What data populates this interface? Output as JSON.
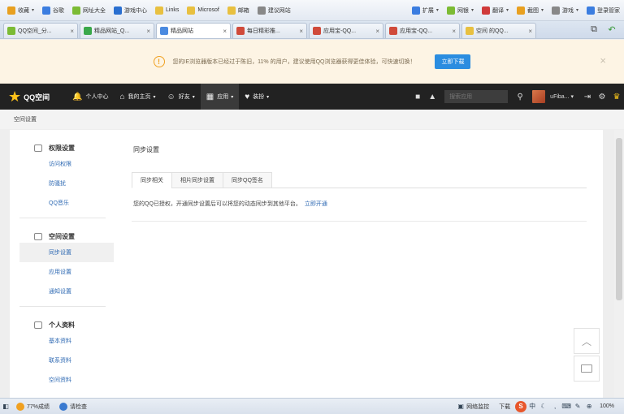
{
  "favorites": [
    {
      "label": "收藏",
      "color": "#e8a020",
      "arrow": true
    },
    {
      "label": "谷歌",
      "color": "#3b7de0",
      "arrow": false
    },
    {
      "label": "网址大全",
      "color": "#7cbb34",
      "arrow": false
    },
    {
      "label": "游戏中心",
      "color": "#2a6fd0",
      "arrow": false
    },
    {
      "label": "Links",
      "color": "#e8c040",
      "arrow": false
    },
    {
      "label": "Microsof",
      "color": "#e8c040",
      "arrow": false
    },
    {
      "label": "邮箱",
      "color": "#e8c040",
      "arrow": false
    },
    {
      "label": "建议网站",
      "color": "#888888",
      "arrow": false
    }
  ],
  "favorites_right": [
    {
      "label": "扩展",
      "color": "#3b7de0",
      "arrow": true
    },
    {
      "label": "网银",
      "color": "#7cbb34",
      "arrow": true
    },
    {
      "label": "翻译",
      "color": "#d03a3a",
      "arrow": true
    },
    {
      "label": "截图",
      "color": "#e8a020",
      "arrow": true
    },
    {
      "label": "游戏",
      "color": "#888888",
      "arrow": true
    },
    {
      "label": "登录管家",
      "color": "#3b7de0",
      "arrow": false
    }
  ],
  "tabs": [
    {
      "label": "QQ空间_分...",
      "color": "#7cbb34",
      "active": false
    },
    {
      "label": "精品网站_Q...",
      "color": "#3aa84a",
      "active": false
    },
    {
      "label": "精品网站",
      "color": "#4a8ae0",
      "active": true
    },
    {
      "label": "每日精彩推...",
      "color": "#d04a3a",
      "active": false
    },
    {
      "label": "应用宝-QQ...",
      "color": "#d04a3a",
      "active": false
    },
    {
      "label": "应用宝-QQ...",
      "color": "#d04a3a",
      "active": false
    },
    {
      "label": "空间 的QQ...",
      "color": "#e8c040",
      "active": false
    }
  ],
  "notice": {
    "message": "您的IE浏览器版本已经过于陈旧，11% 的用户，建议使用QQ浏览器获得更佳体验，可快速切换！",
    "download_label": "立即下载",
    "close_glyph": "×",
    "warn_glyph": "!"
  },
  "qqnav": {
    "logo_text": "QQ空间",
    "items": [
      {
        "label": "个人中心",
        "glyph": "🔔",
        "caret": false,
        "active": false
      },
      {
        "label": "我的主页",
        "glyph": "⌂",
        "caret": true,
        "active": false
      },
      {
        "label": "好友",
        "glyph": "☺",
        "caret": true,
        "active": false
      },
      {
        "label": "应用",
        "glyph": "▦",
        "caret": true,
        "active": true
      },
      {
        "label": "装扮",
        "glyph": "♥",
        "caret": true,
        "active": false
      }
    ],
    "search_placeholder": "搜索应用",
    "username": "uFiba...",
    "username_caret": "▾"
  },
  "breadcrumb": "空间设置",
  "sidebar": {
    "groups": [
      {
        "title": "权限设置",
        "items": [
          {
            "label": "访问权限",
            "active": false
          },
          {
            "label": "防骚扰",
            "active": false
          },
          {
            "label": "QQ音乐",
            "active": false
          }
        ]
      },
      {
        "title": "空间设置",
        "items": [
          {
            "label": "同步设置",
            "active": true
          },
          {
            "label": "应用设置",
            "active": false
          },
          {
            "label": "通知设置",
            "active": false
          }
        ]
      },
      {
        "title": "个人资料",
        "items": [
          {
            "label": "基本资料",
            "active": false
          },
          {
            "label": "联系资料",
            "active": false
          },
          {
            "label": "空间资料",
            "active": false
          }
        ]
      }
    ]
  },
  "content": {
    "title": "同步设置",
    "tabs": [
      {
        "label": "同步相关",
        "active": true
      },
      {
        "label": "相片同步设置",
        "active": false
      },
      {
        "label": "同步QQ签名",
        "active": false
      }
    ],
    "desc": "您的QQ已授权，开通同步设置后可以将您的动态同步到其他平台。",
    "desc_link": "立即开通"
  },
  "float": {
    "up_glyph": "︿"
  },
  "status": {
    "left_items": [
      {
        "label": "77%成绩",
        "color": "#f0a020"
      },
      {
        "label": "请检查",
        "color": "#3a7ad0"
      }
    ],
    "right_label": "网络监控",
    "download_label": "下载",
    "zoom": "100%",
    "badge_text": "S"
  }
}
